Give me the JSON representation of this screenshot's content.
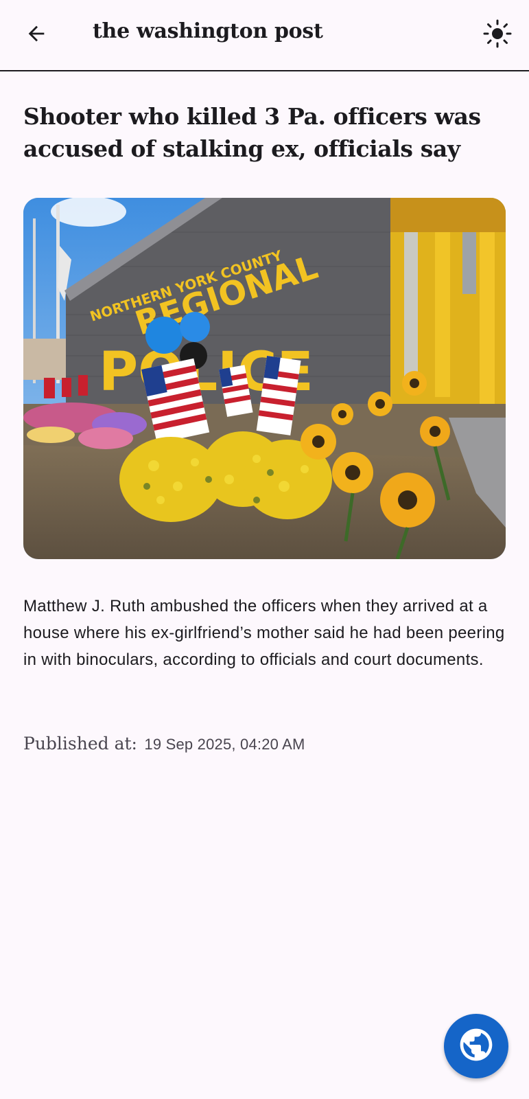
{
  "appbar": {
    "title": "the washington post",
    "back_icon": "arrow-back-icon",
    "theme_icon": "sun-icon"
  },
  "article": {
    "headline": "Shooter who killed 3 Pa. officers was accused of stalking ex, officials say",
    "hero_sign_line1": "NORTHERN YORK COUNTY",
    "hero_sign_line2": "REGIONAL",
    "hero_sign_line3": "POLICE",
    "description": "Matthew J. Ruth ambushed the officers when they arrived at a house where his ex-girlfriend’s mother said he had been peering in with binoculars, according to officials and court documents.",
    "published_label": "Published at:",
    "published_value": "19 Sep 2025, 04:20 AM"
  },
  "fab": {
    "icon": "globe-icon",
    "color": "#1565c8"
  },
  "colors": {
    "background": "#fdf8fd",
    "text": "#1c1b1f",
    "muted": "#49454f"
  }
}
